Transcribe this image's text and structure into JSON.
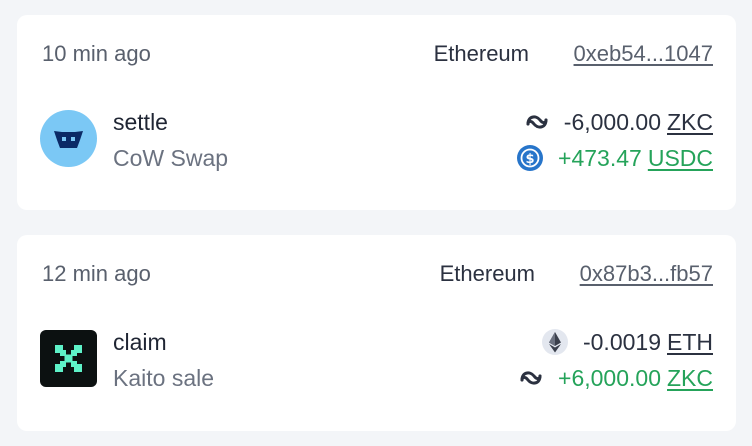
{
  "transactions": [
    {
      "time": "10 min ago",
      "chain": "Ethereum",
      "address": "0xeb54...1047",
      "action": "settle",
      "app": "CoW Swap",
      "avatar_icon": "cow-swap-logo-icon",
      "transfers": [
        {
          "amount": "-6,000.00",
          "symbol": "ZKC",
          "icon": "zkc-token-icon",
          "direction": "out"
        },
        {
          "amount": "+473.47",
          "symbol": "USDC",
          "icon": "usdc-token-icon",
          "direction": "in"
        }
      ]
    },
    {
      "time": "12 min ago",
      "chain": "Ethereum",
      "address": "0x87b3...fb57",
      "action": "claim",
      "app": "Kaito sale",
      "avatar_icon": "kaito-logo-icon",
      "transfers": [
        {
          "amount": "-0.0019",
          "symbol": "ETH",
          "icon": "eth-token-icon",
          "direction": "out"
        },
        {
          "amount": "+6,000.00",
          "symbol": "ZKC",
          "icon": "zkc-token-icon",
          "direction": "in"
        }
      ]
    }
  ],
  "colors": {
    "positive": "#25a35a",
    "negative": "#2b3140",
    "card": "#ffffff",
    "background": "#f3f5f8"
  }
}
